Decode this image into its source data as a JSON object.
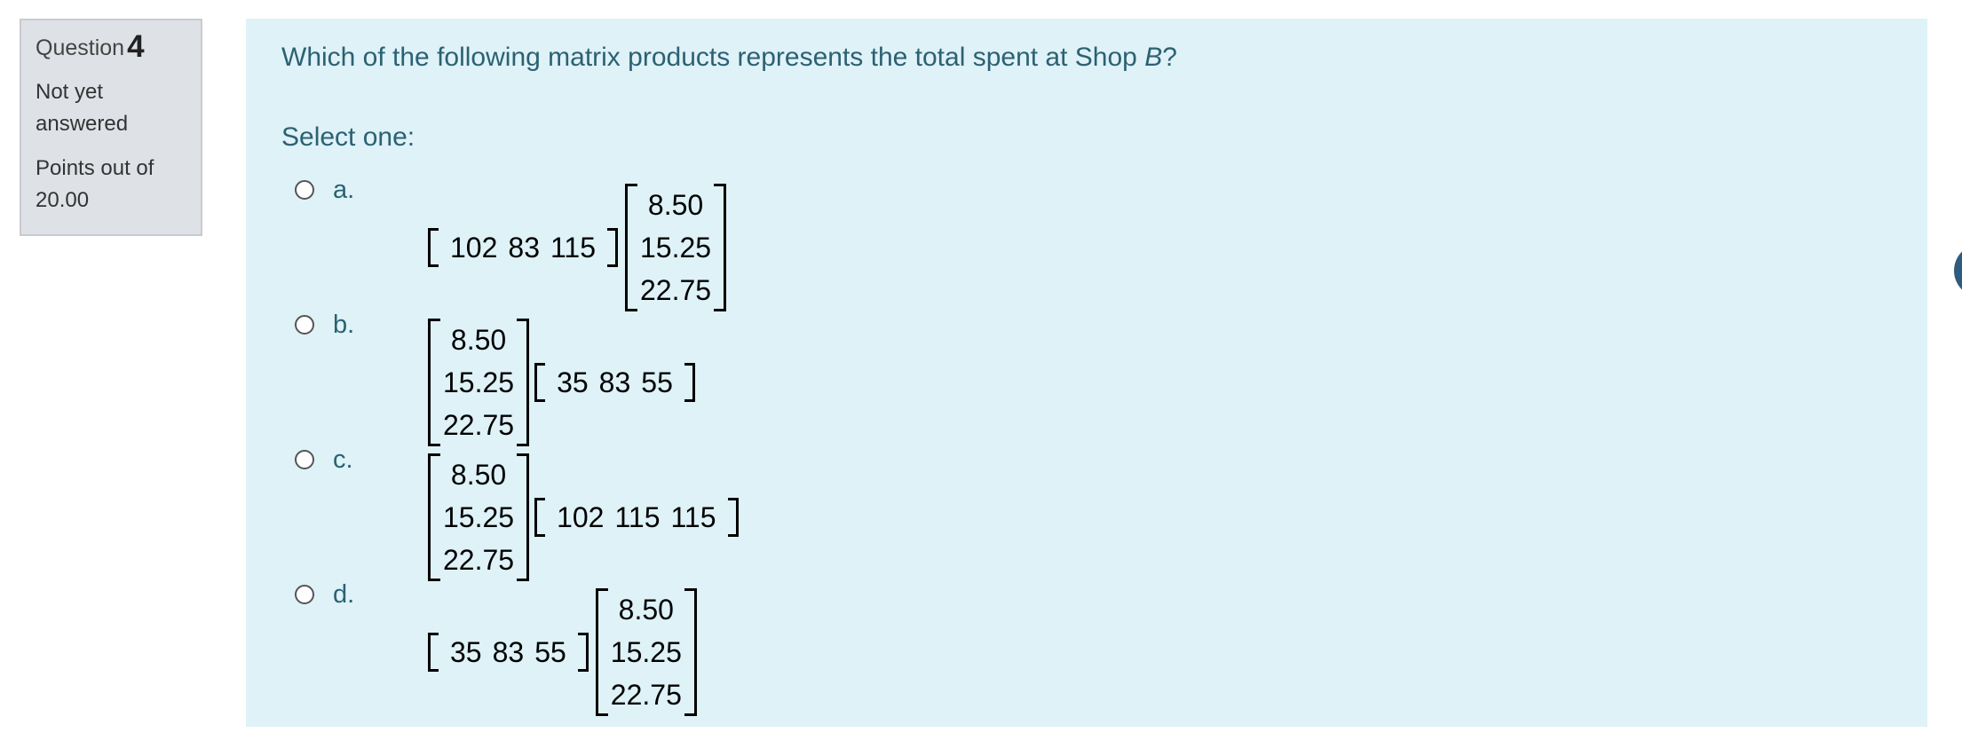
{
  "info": {
    "question_label": "Question",
    "question_number": "4",
    "state": "Not yet answered",
    "grade": "Points out of 20.00"
  },
  "question": {
    "text_prefix": "Which of the following matrix products represents the total spent at Shop ",
    "text_shop": "B",
    "text_suffix": "?",
    "prompt": "Select one:"
  },
  "options": [
    {
      "letter": "a.",
      "left_row": [
        "102",
        "83",
        "115"
      ],
      "right_col": [
        "8.50",
        "15.25",
        "22.75"
      ]
    },
    {
      "letter": "b.",
      "left_col": [
        "8.50",
        "15.25",
        "22.75"
      ],
      "right_row": [
        "35",
        "83",
        "55"
      ]
    },
    {
      "letter": "c.",
      "left_col": [
        "8.50",
        "15.25",
        "22.75"
      ],
      "right_row": [
        "102",
        "115",
        "115"
      ]
    },
    {
      "letter": "d.",
      "left_row": [
        "35",
        "83",
        "55"
      ],
      "right_col": [
        "8.50",
        "15.25",
        "22.75"
      ]
    }
  ],
  "colors": {
    "panel_bg": "#def2f8",
    "text": "#2c6172",
    "info_bg": "#dee2e6"
  }
}
